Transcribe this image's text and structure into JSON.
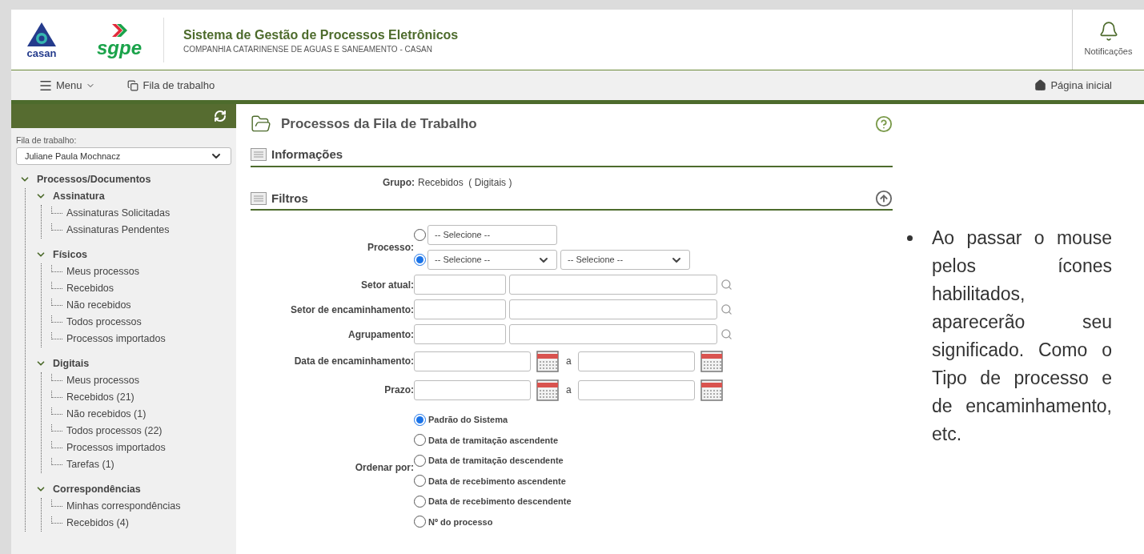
{
  "header": {
    "title": "Sistema de Gestão de Processos Eletrônicos",
    "subtitle": "COMPANHIA CATARINENSE DE AGUAS E SANEAMENTO - CASAN",
    "logo_text": "casan",
    "app_logo_text": "sgpe",
    "notifications": "Notificações"
  },
  "navbar": {
    "menu": "Menu",
    "worklist": "Fila de trabalho",
    "home": "Página inicial"
  },
  "sidebar": {
    "queue_label": "Fila de trabalho:",
    "queue_value": "Juliane Paula Mochnacz",
    "tree": [
      {
        "label": "Processos/Documentos",
        "expanded": true,
        "children": [
          {
            "label": "Assinatura",
            "expanded": true,
            "children": [
              {
                "label": "Assinaturas Solicitadas"
              },
              {
                "label": "Assinaturas Pendentes"
              }
            ]
          },
          {
            "label": "Físicos",
            "expanded": true,
            "children": [
              {
                "label": "Meus processos"
              },
              {
                "label": "Recebidos"
              },
              {
                "label": "Não recebidos"
              },
              {
                "label": "Todos processos"
              },
              {
                "label": "Processos importados"
              }
            ]
          },
          {
            "label": "Digitais",
            "expanded": true,
            "children": [
              {
                "label": "Meus processos"
              },
              {
                "label": "Recebidos (21)"
              },
              {
                "label": "Não recebidos (1)"
              },
              {
                "label": "Todos processos (22)"
              },
              {
                "label": "Processos importados"
              },
              {
                "label": "Tarefas (1)"
              }
            ]
          },
          {
            "label": "Correspondências",
            "expanded": true,
            "children": [
              {
                "label": "Minhas correspondências"
              },
              {
                "label": "Recebidos (4)"
              }
            ]
          }
        ]
      }
    ]
  },
  "main": {
    "title": "Processos da Fila de Trabalho",
    "info": {
      "heading": "Informações",
      "group_label": "Grupo:",
      "group_value": "Recebidos  ( Digitais )"
    },
    "filters": {
      "heading": "Filtros",
      "processo": {
        "label": "Processo:",
        "options": [
          {
            "selected": false,
            "fields": [
              "-- Selecione --"
            ],
            "kind": "text"
          },
          {
            "selected": true,
            "fields": [
              "-- Selecione --",
              "-- Selecione --"
            ],
            "kind": "select"
          }
        ]
      },
      "text_rows": [
        {
          "label": "Setor atual:"
        },
        {
          "label": "Setor de encaminhamento:"
        },
        {
          "label": "Agrupamento:"
        }
      ],
      "date_rows": [
        {
          "label": "Data de encaminhamento:",
          "separator": "a"
        },
        {
          "label": "Prazo:",
          "separator": "a"
        }
      ],
      "order": {
        "label": "Ordenar por:",
        "options": [
          {
            "label": "Padrão do Sistema",
            "selected": true
          },
          {
            "label": "Data de tramitação ascendente",
            "selected": false
          },
          {
            "label": "Data de tramitação descendente",
            "selected": false
          },
          {
            "label": "Data de recebimento ascendente",
            "selected": false
          },
          {
            "label": "Data de recebimento descendente",
            "selected": false
          },
          {
            "label": "Nº do processo",
            "selected": false
          }
        ]
      }
    }
  },
  "note": "Ao passar o mouse pelos ícones habilitados, aparecerão seu significado. Como o Tipo de processo e de encaminhamento, etc."
}
